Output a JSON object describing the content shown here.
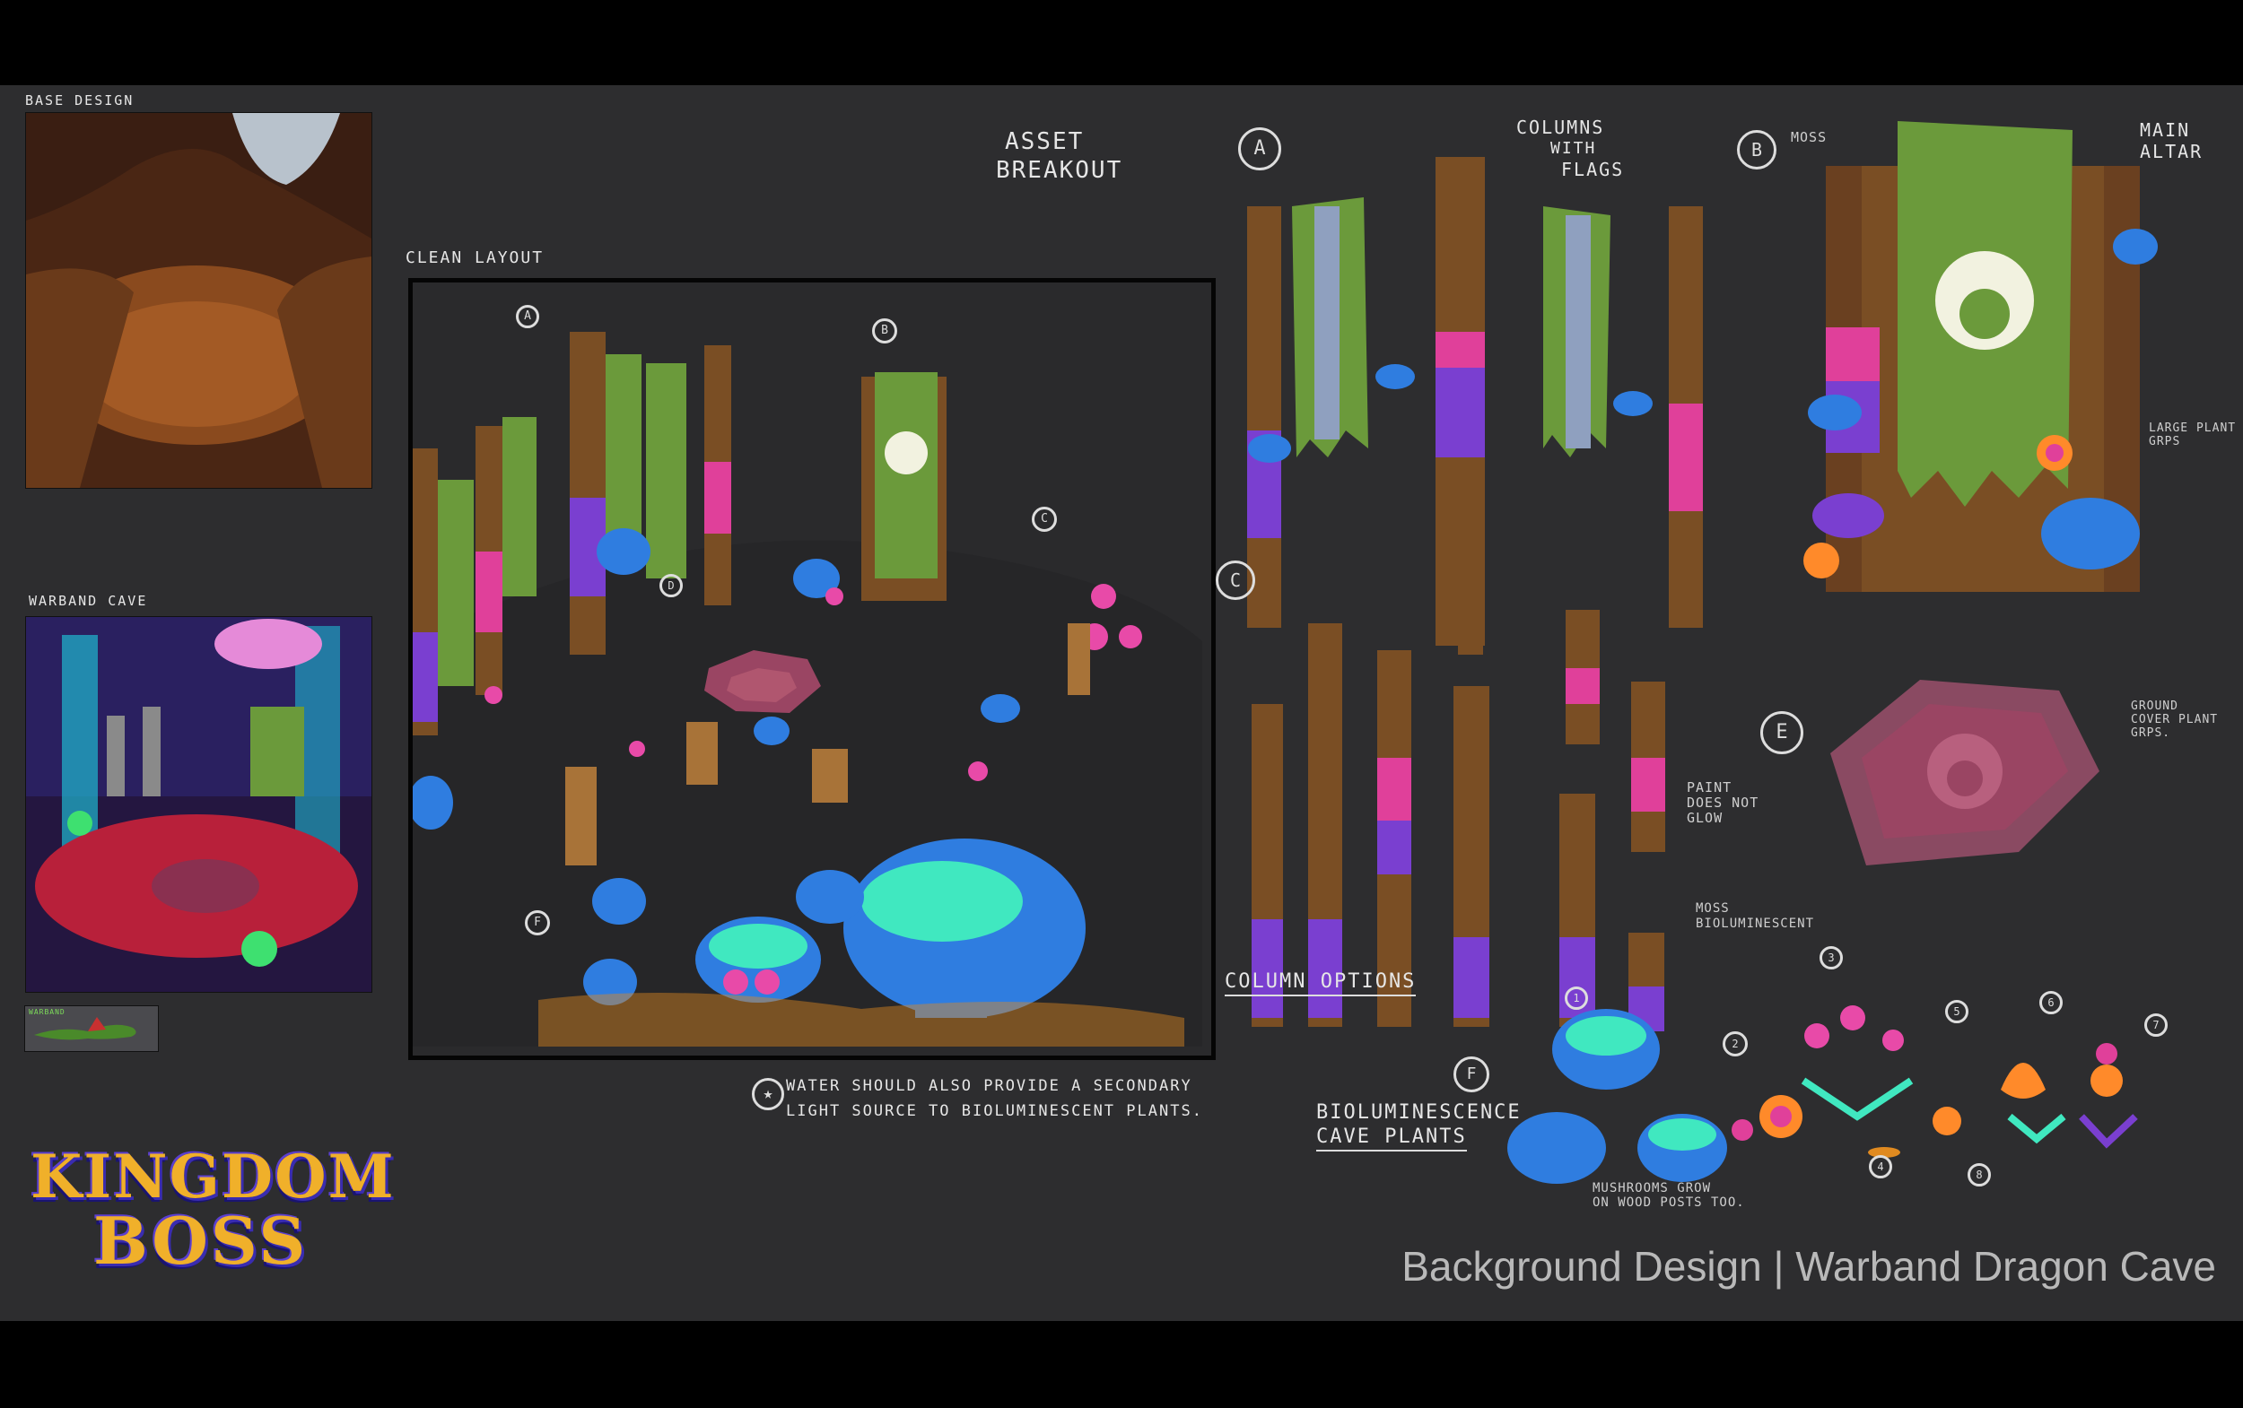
{
  "labels": {
    "base_design": "BASE DESIGN",
    "warband_cave": "WARBAND CAVE",
    "warband_tag": "WARBAND",
    "clean_layout": "CLEAN LAYOUT",
    "asset_breakout_line1": "ASSET",
    "asset_breakout_line2": "BREAKOUT",
    "columns_line1": "COLUMNS",
    "columns_line2": "WITH",
    "columns_line3": "FLAGS",
    "moss": "MOSS",
    "main_altar_line1": "MAIN",
    "main_altar_line2": "ALTAR",
    "large_plant_line1": "LARGE PLANT",
    "large_plant_line2": "GRPS",
    "ground_cover_line1": "GROUND",
    "ground_cover_line2": "COVER PLANT",
    "ground_cover_line3": "GRPS.",
    "paint_line1": "PAINT",
    "paint_line2": "DOES NOT",
    "paint_line3": "GLOW",
    "moss_bio_line1": "MOSS",
    "moss_bio_line2": "BIOLUMINESCENT",
    "column_options": "COLUMN OPTIONS",
    "bio_plants_line1": "BIOLUMINESCENCE",
    "bio_plants_line2": "CAVE PLANTS",
    "mushrooms_note_line1": "MUSHROOMS GROW",
    "mushrooms_note_line2": "ON WOOD POSTS TOO.",
    "water_note_line1": "WATER SHOULD ALSO PROVIDE A SECONDARY",
    "water_note_line2": "LIGHT SOURCE TO BIOLUMINESCENT PLANTS."
  },
  "markers": {
    "a": "A",
    "b": "B",
    "c": "C",
    "d": "D",
    "e": "E",
    "f": "F",
    "star": "★",
    "n1": "1",
    "n2": "2",
    "n3": "3",
    "n4": "4",
    "n5": "5",
    "n6": "6",
    "n7": "7",
    "n8": "8"
  },
  "logo": {
    "line1": "KINGDOM",
    "line2": "BOSS"
  },
  "footer_title": "Background Design | Warband Dragon Cave",
  "colors": {
    "background": "#2d2d2f",
    "banner_green": "#6b9a3b",
    "mushroom_blue": "#2f7de0",
    "mushroom_cyan": "#40e8c0",
    "wood_brown": "#7a4e24",
    "glow_pink": "#e0409a",
    "glow_purple": "#7a3fd0",
    "altar_tile": "#9a4563",
    "title_gray": "#b9b9b9",
    "logo_gold": "#f0b02a"
  }
}
